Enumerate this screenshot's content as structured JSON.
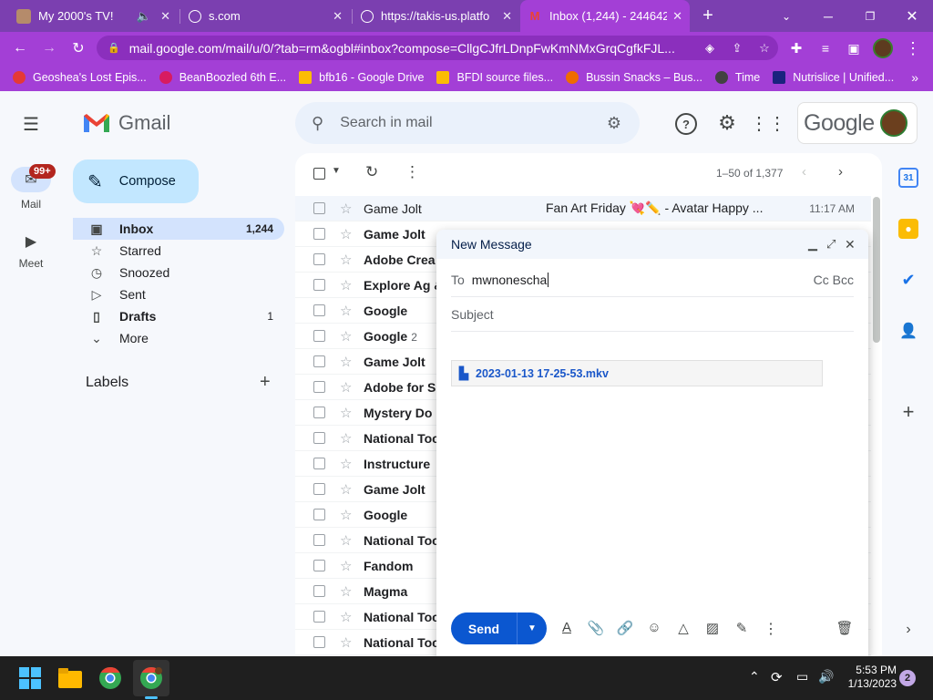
{
  "browser": {
    "tabs": [
      {
        "title": "My 2000's TV!",
        "has_audio": true
      },
      {
        "title": "s.com"
      },
      {
        "title": "https://takis-us.platfo"
      },
      {
        "title": "Inbox (1,244) - 244642",
        "active": true
      }
    ],
    "new_tab_symbol": "+",
    "url": "mail.google.com/mail/u/0/?tab=rm&ogbl#inbox?compose=CllgCJfrLDnpFwKmNMxGrqCgfkFJL...",
    "bookmarks": [
      {
        "label": "Geoshea's Lost Epis...",
        "color": "#e53935"
      },
      {
        "label": "BeanBoozled 6th E...",
        "color": "#d81b60"
      },
      {
        "label": "bfb16 - Google Drive",
        "color": "#fbbc04"
      },
      {
        "label": "BFDI source files...",
        "color": "#fbbc04"
      },
      {
        "label": "Bussin Snacks – Bus...",
        "color": "#ef6c00"
      },
      {
        "label": "Time",
        "color": "#424242"
      },
      {
        "label": "Nutrislice | Unified...",
        "color": "#1a237e"
      }
    ]
  },
  "gmail": {
    "logo_text": "Gmail",
    "search_placeholder": "Search in mail",
    "google_text": "Google",
    "left_nav": {
      "mail_label": "Mail",
      "mail_badge": "99+",
      "meet_label": "Meet"
    },
    "compose_label": "Compose",
    "folders": [
      {
        "label": "Inbox",
        "count": "1,244",
        "icon": "inbox-icon",
        "active": true
      },
      {
        "label": "Starred",
        "count": "",
        "icon": "star-icon"
      },
      {
        "label": "Snoozed",
        "count": "",
        "icon": "clock-icon"
      },
      {
        "label": "Sent",
        "count": "",
        "icon": "send-icon"
      },
      {
        "label": "Drafts",
        "count": "1",
        "icon": "draft-icon",
        "bold": true
      },
      {
        "label": "More",
        "count": "",
        "icon": "chevron-down-icon"
      }
    ],
    "labels_heading": "Labels",
    "labels_add": "+",
    "pagination": "1–50 of 1,377",
    "emails": [
      {
        "sender": "Game Jolt",
        "subject": "Fan Art Friday 💘✏️ - Avatar Happy ...",
        "time": "11:17 AM",
        "read": true
      },
      {
        "sender": "Game Jolt"
      },
      {
        "sender": "Adobe Crea"
      },
      {
        "sender": "Explore Ag &"
      },
      {
        "sender": "Google"
      },
      {
        "sender": "Google",
        "count": "2"
      },
      {
        "sender": "Game Jolt"
      },
      {
        "sender": "Adobe for S"
      },
      {
        "sender": "Mystery Do"
      },
      {
        "sender": "National Toc"
      },
      {
        "sender": "Instructure"
      },
      {
        "sender": "Game Jolt"
      },
      {
        "sender": "Google"
      },
      {
        "sender": "National Toc"
      },
      {
        "sender": "Fandom"
      },
      {
        "sender": "Magma"
      },
      {
        "sender": "National Toc"
      },
      {
        "sender": "National Toc"
      }
    ]
  },
  "compose": {
    "title": "New Message",
    "to_label": "To",
    "to_value": "mwnonescha",
    "cc_bcc": "Cc Bcc",
    "subject_placeholder": "Subject",
    "attachment_name": "2023-01-13 17-25-53.mkv",
    "send_label": "Send"
  },
  "taskbar": {
    "time": "5:53 PM",
    "date": "1/13/2023",
    "notification_count": "2"
  }
}
